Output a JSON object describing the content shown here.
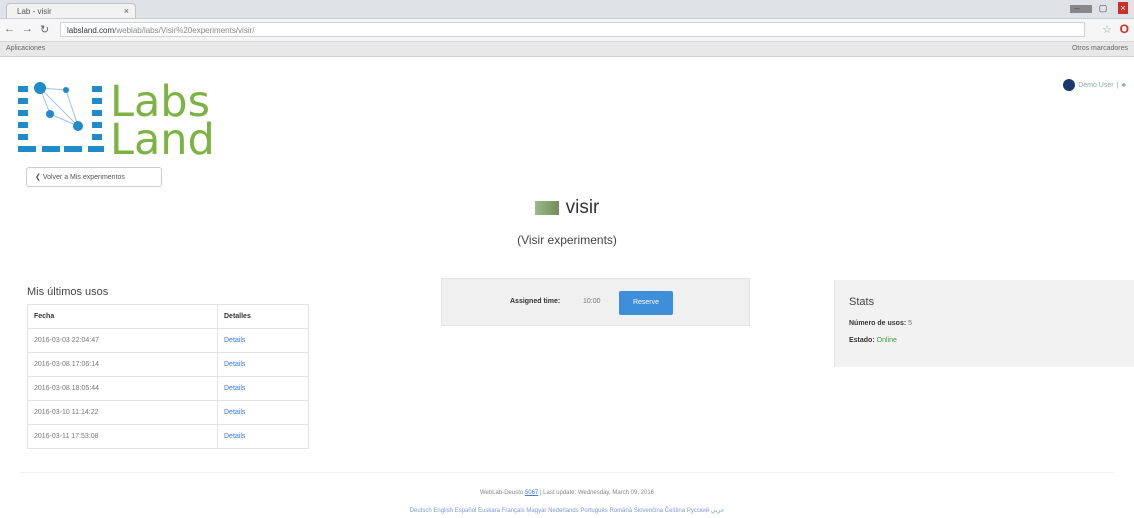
{
  "browser": {
    "tab_title": "Lab - visir",
    "tab_close": "×",
    "url_host": "labsland.com",
    "url_path": "/weblab/labs/Visir%20experiments/visir/",
    "bookmarks_apps": "Aplicaciones",
    "bookmarks_other": "Otros marcadores"
  },
  "logo": {
    "line1": "Labs",
    "line2": "Land"
  },
  "back_button": {
    "label": "Volver a Mis experimentos"
  },
  "account": {
    "user": "Demo User",
    "sep": "|"
  },
  "lab": {
    "name": "visir",
    "subtitle": "(Visir experiments)"
  },
  "uses": {
    "title": "Mis últimos usos",
    "headers": [
      "Fecha",
      "Detalles"
    ],
    "rows": [
      {
        "date": "2016-03-03 22:04:47",
        "details": "Details"
      },
      {
        "date": "2016-03-08 17:06:14",
        "details": "Details"
      },
      {
        "date": "2016-03-08 18:05:44",
        "details": "Details"
      },
      {
        "date": "2016-03-10 11:14:22",
        "details": "Details"
      },
      {
        "date": "2016-03-11 17:53:08",
        "details": "Details"
      }
    ]
  },
  "assignment": {
    "label": "Assigned time:",
    "value": "10:00",
    "reserve": "Reserve"
  },
  "stats": {
    "title": "Stats",
    "uses_label": "Número de usos:",
    "uses_value": "5",
    "status_label": "Estado:",
    "status_value": "Online"
  },
  "footer": {
    "line1_pre": "WebLab-Deusto",
    "line1_link": "5067",
    "line1_post": "| Last update: Wednesday, March 09, 2016",
    "languages": "Deutsch English Español Euskara Français Magyar Nederlands Português Română Slovenčina Čeština Русский عربي"
  },
  "colors": {
    "accent": "#3c8fd8",
    "brand_green": "#7cb342",
    "brand_blue": "#1f8bc9"
  }
}
